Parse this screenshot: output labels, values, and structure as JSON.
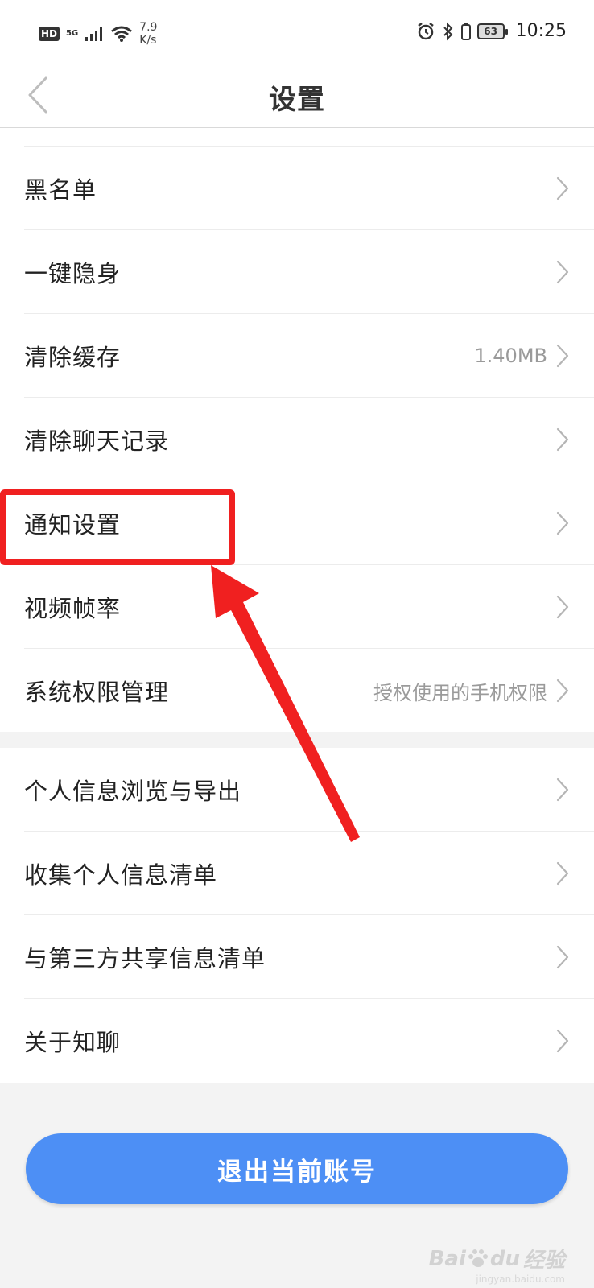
{
  "status_bar": {
    "hd": "HD",
    "network": "5G",
    "speed_value": "7.9",
    "speed_unit": "K/s",
    "battery": "63",
    "time": "10:25"
  },
  "header": {
    "title": "设置"
  },
  "group1": [
    {
      "label": "黑名单",
      "value": ""
    },
    {
      "label": "一键隐身",
      "value": ""
    },
    {
      "label": "清除缓存",
      "value": "1.40MB"
    },
    {
      "label": "清除聊天记录",
      "value": ""
    },
    {
      "label": "通知设置",
      "value": ""
    },
    {
      "label": "视频帧率",
      "value": ""
    },
    {
      "label": "系统权限管理",
      "value": "授权使用的手机权限"
    }
  ],
  "group2": [
    {
      "label": "个人信息浏览与导出"
    },
    {
      "label": "收集个人信息清单"
    },
    {
      "label": "与第三方共享信息清单"
    },
    {
      "label": "关于知聊"
    }
  ],
  "logout": {
    "label": "退出当前账号"
  },
  "watermark": {
    "brand": "Bai",
    "brand_suffix": "du",
    "text": "经验",
    "sub": "jingyan.baidu.com"
  },
  "colors": {
    "accent": "#4d8ff5",
    "highlight": "#f02020"
  },
  "icons": [
    "hd-icon",
    "signal-icon",
    "wifi-icon",
    "alarm-icon",
    "bluetooth-icon",
    "battery-icon",
    "back-arrow-icon",
    "chevron-right-icon",
    "paw-icon"
  ]
}
